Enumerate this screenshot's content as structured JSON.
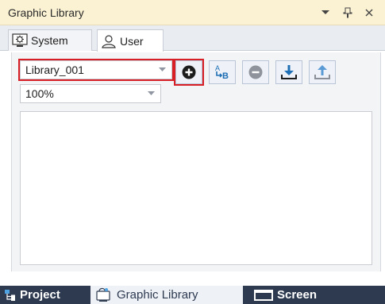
{
  "panel": {
    "title": "Graphic Library"
  },
  "title_controls": [
    {
      "name": "dropdown-icon"
    },
    {
      "name": "pin-icon"
    },
    {
      "name": "close-icon"
    }
  ],
  "tabs": [
    {
      "label": "System",
      "icon": "system-library-icon",
      "active": false
    },
    {
      "label": "User",
      "icon": "user-icon",
      "active": true
    }
  ],
  "library_select": {
    "value": "Library_001",
    "highlighted": true
  },
  "zoom_select": {
    "value": "100%"
  },
  "toolbar": [
    {
      "name": "add-library-button",
      "icon": "plus-circle-icon",
      "highlighted": true
    },
    {
      "name": "rename-library-button",
      "icon": "rename-ab-icon"
    },
    {
      "name": "delete-library-button",
      "icon": "minus-circle-icon"
    },
    {
      "name": "import-library-button",
      "icon": "download-icon"
    },
    {
      "name": "export-library-button",
      "icon": "upload-icon"
    }
  ],
  "bottom_tabs": [
    {
      "label": "Project",
      "icon": "project-tree-icon",
      "active": false
    },
    {
      "label": "Graphic Library",
      "icon": "graphic-library-icon",
      "active": true
    },
    {
      "label": "Screen",
      "icon": "screen-icon",
      "active": false
    }
  ],
  "colors": {
    "title_bg": "#fbf2d3",
    "highlight": "#d81f26",
    "dock_bg": "#2d3a50",
    "toolbar_icon": "#1f6fb5"
  }
}
